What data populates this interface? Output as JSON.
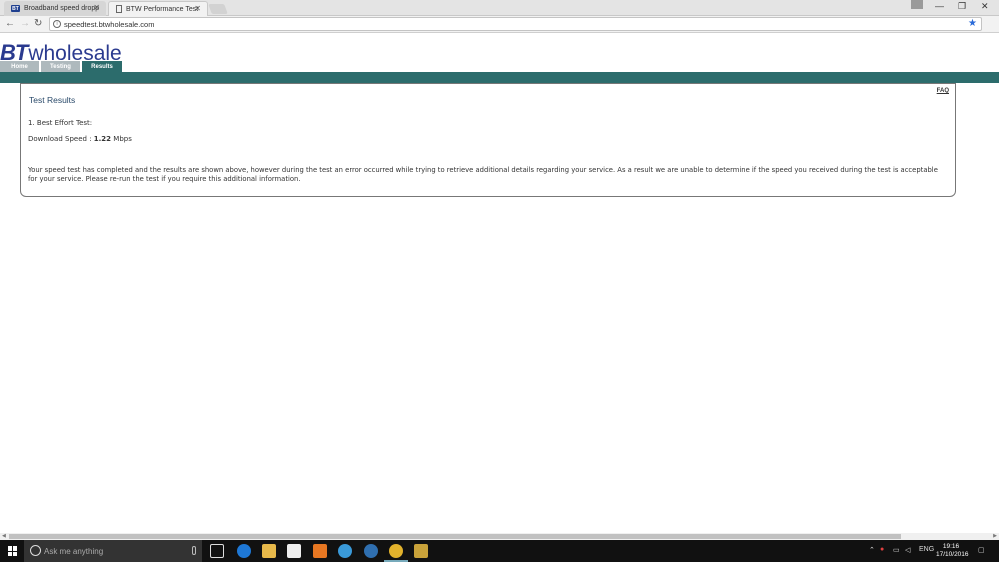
{
  "browser": {
    "tabs": [
      {
        "label": "Broadband speed dropp",
        "favicon": "BT"
      },
      {
        "label": "BTW Performance Test"
      }
    ],
    "url": "speedtest.btwholesale.com"
  },
  "site": {
    "logo_bt": "BT",
    "logo_wholesale": "wholesale",
    "nav": [
      "Home",
      "Testing",
      "Results"
    ],
    "active_nav": "Results"
  },
  "results": {
    "faq_label": "FAQ",
    "title": "Test Results",
    "test_name": "1. Best Effort Test:",
    "speed_label": "Download Speed :",
    "speed_value": "1.22",
    "speed_unit": "Mbps",
    "message": "Your speed test has completed and the results are shown above, however during the test an error occurred while trying to retrieve additional details regarding your service. As a result we are unable to determine if the speed you received during the test is acceptable for your service. Please re-run the test if you require this additional information."
  },
  "taskbar": {
    "search_placeholder": "Ask me anything",
    "language": "ENG",
    "time": "19:16",
    "date": "17/10/2016"
  },
  "colors": {
    "teal": "#2c6c6c",
    "bt_blue": "#2a3a8f"
  }
}
